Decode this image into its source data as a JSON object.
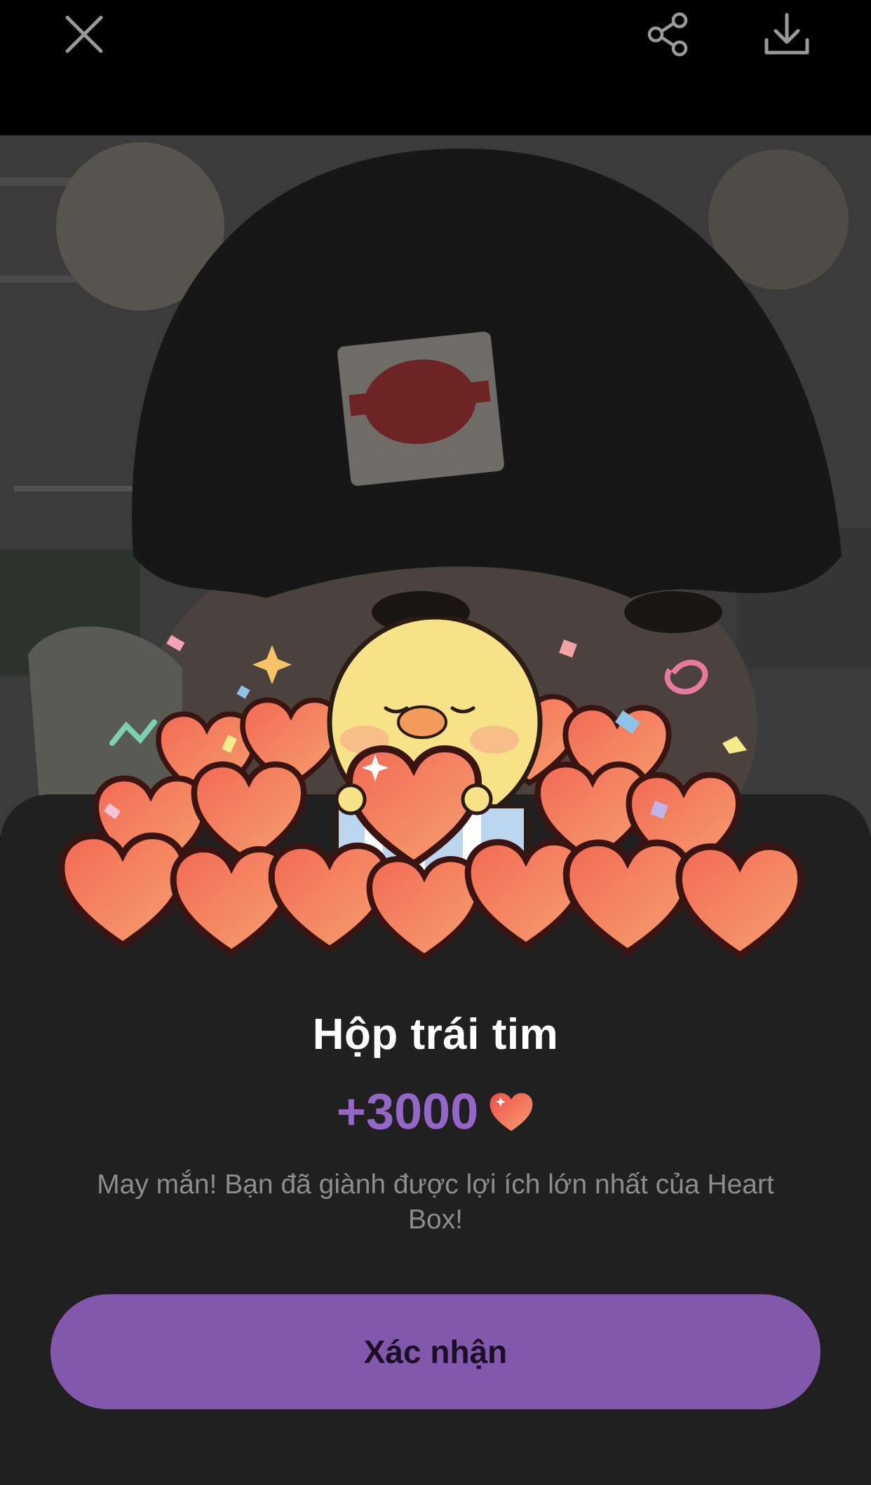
{
  "toolbar": {
    "close_icon": "close-icon",
    "share_icon": "share-icon",
    "download_icon": "download-icon"
  },
  "reward_card": {
    "title": "Hộp trái tim",
    "amount": "+3000",
    "amount_icon": "heart-icon",
    "message": "May mắn! Bạn đã giành được lợi ích lớn nhất của Heart Box!",
    "confirm_label": "Xác nhận"
  },
  "colors": {
    "accent": "#8158ab",
    "amount_text": "#9466c8",
    "sheet_bg": "#202021",
    "heart": "#ef6b5a"
  }
}
